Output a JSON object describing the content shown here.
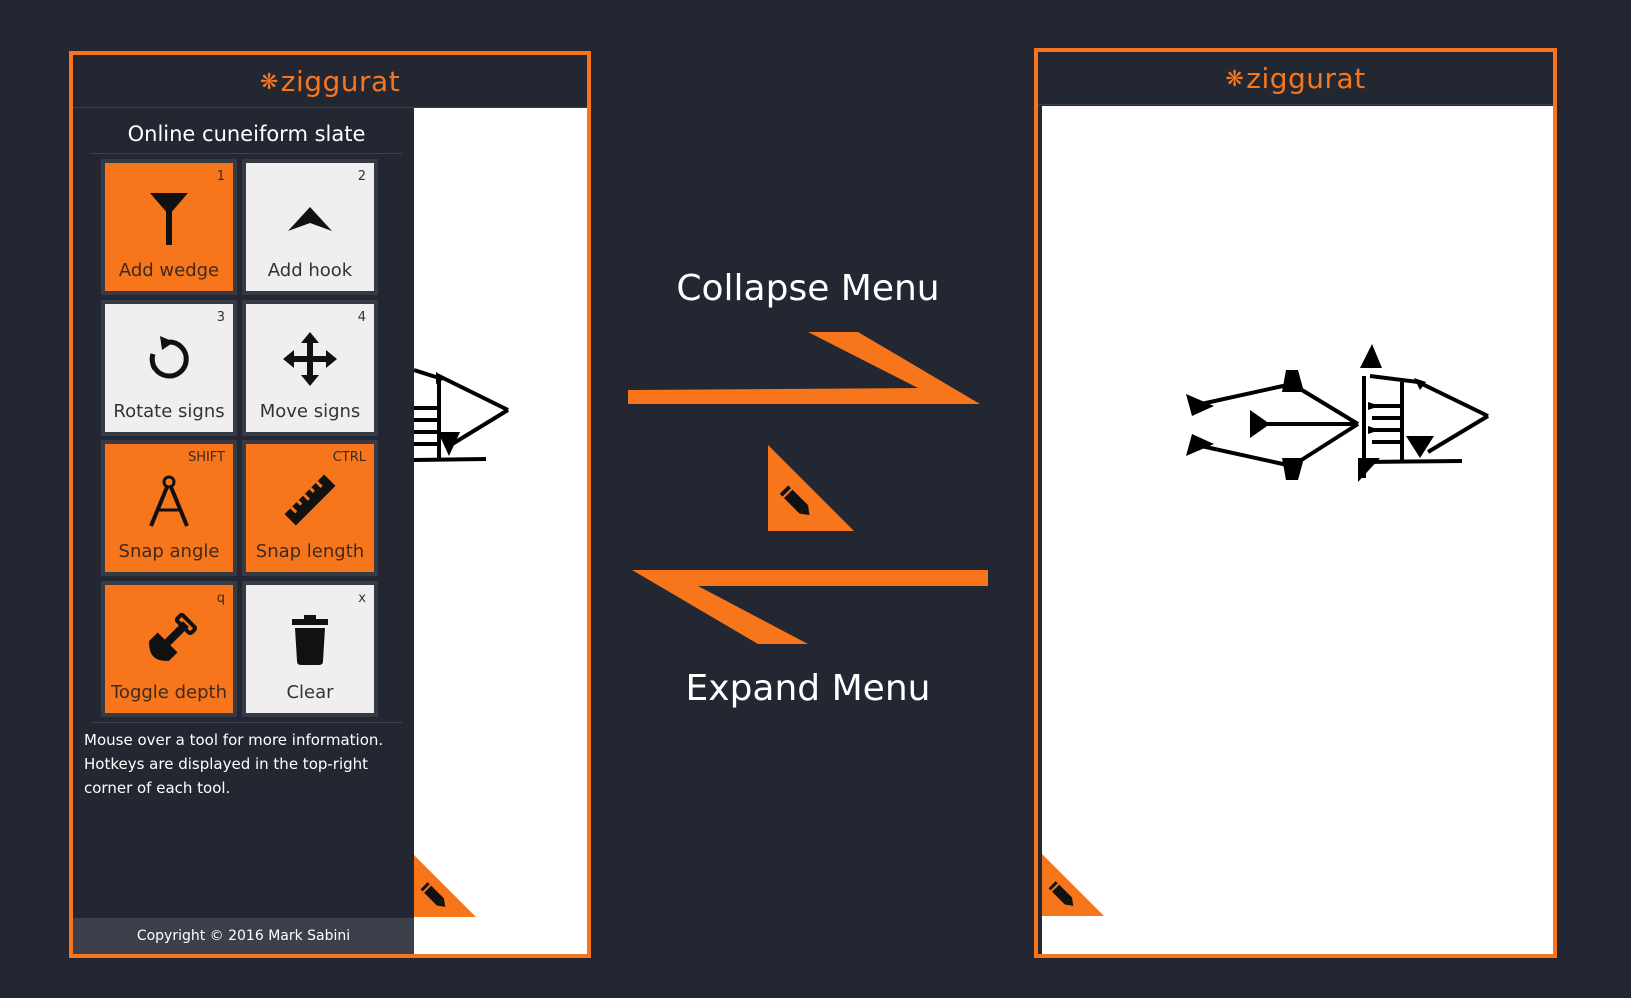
{
  "colors": {
    "accent": "#f7761b",
    "background": "#232731",
    "canvas": "#ffffff",
    "footer": "#3b404b"
  },
  "app": {
    "logo_mark": "❋",
    "logo_text": "ziggurat"
  },
  "sidebar": {
    "title": "Online cuneiform slate",
    "tools": [
      {
        "label": "Add wedge",
        "hotkey": "1",
        "active": true,
        "icon": "wedge-icon"
      },
      {
        "label": "Add hook",
        "hotkey": "2",
        "active": false,
        "icon": "hook-icon"
      },
      {
        "label": "Rotate signs",
        "hotkey": "3",
        "active": false,
        "icon": "rotate-icon"
      },
      {
        "label": "Move signs",
        "hotkey": "4",
        "active": false,
        "icon": "move-icon"
      },
      {
        "label": "Snap angle",
        "hotkey": "SHIFT",
        "active": true,
        "icon": "compass-icon"
      },
      {
        "label": "Snap length",
        "hotkey": "CTRL",
        "active": true,
        "icon": "ruler-icon"
      },
      {
        "label": "Toggle depth",
        "hotkey": "q",
        "active": true,
        "icon": "shovel-icon"
      },
      {
        "label": "Clear",
        "hotkey": "x",
        "active": false,
        "icon": "trash-icon"
      }
    ],
    "help_text": "Mouse over a tool for more information. Hotkeys are displayed in the top-right corner of each tool.",
    "footer": "Copyright © 2016 Mark Sabini"
  },
  "middle": {
    "collapse_label": "Collapse Menu",
    "expand_label": "Expand Menu",
    "toggle_icon": "pencil-icon"
  }
}
